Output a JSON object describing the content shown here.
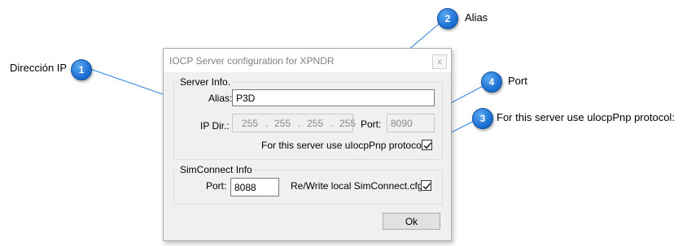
{
  "callouts": {
    "c1": {
      "number": "1",
      "label": "Dirección IP"
    },
    "c2": {
      "number": "2",
      "label": "Alias"
    },
    "c3": {
      "number": "3",
      "label": "For this server use ulocpPnp protocol:"
    },
    "c4": {
      "number": "4",
      "label": "Port"
    }
  },
  "dialog": {
    "title": "IOCP Server configuration for XPNDR",
    "close_glyph": "x",
    "server_info": {
      "legend": "Server Info.",
      "alias_label": "Alias:",
      "alias_value": "P3D",
      "ip_label": "IP Dir.:",
      "ip_parts": [
        "255",
        "255",
        "255",
        "255"
      ],
      "ip_dot": ".",
      "port_label": "Port:",
      "port_value": "8090",
      "protocol_label": "For this server use uIocpPnp protocol:",
      "protocol_checked": true
    },
    "simconnect": {
      "legend": "SimConnect Info",
      "port_label": "Port:",
      "port_value": "8088",
      "rewrite_label": "Re/Write local SimConnect.cfg:",
      "rewrite_checked": true
    },
    "ok_label": "Ok"
  },
  "colors": {
    "badge": "#1f73d6",
    "leader_line": "#2a86e0"
  }
}
